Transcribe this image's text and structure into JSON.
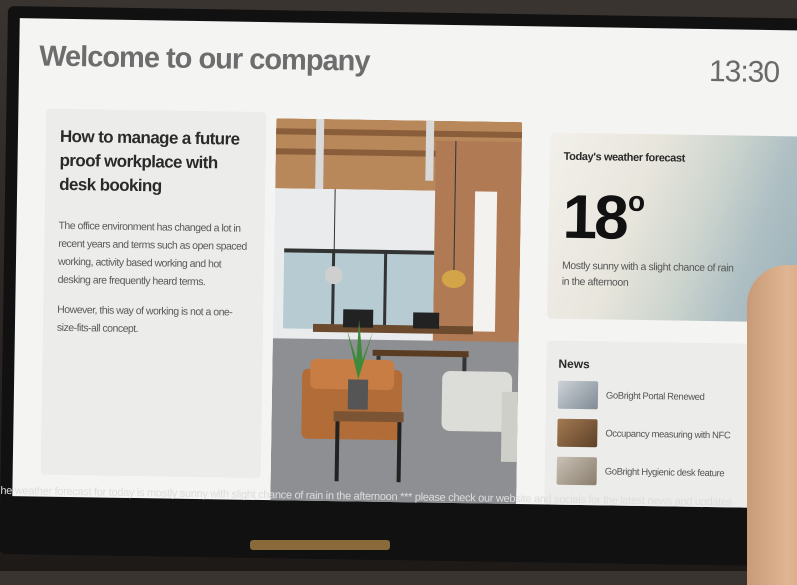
{
  "header": {
    "title": "Welcome to our company",
    "clock": "13:30"
  },
  "article": {
    "title": "How to manage a future proof workplace with desk booking",
    "paragraphs": [
      "The office environment has changed a lot in recent years and terms such as open spaced working, activity based working and hot desking are frequently heard terms.",
      "However, this way of working is not a one-size-fits-all concept."
    ]
  },
  "weather": {
    "title": "Today's weather forecast",
    "temperature": "18",
    "degree_symbol": "o",
    "description": "Mostly sunny with a slight chance of rain in the afternoon"
  },
  "news": {
    "title": "News",
    "items": [
      {
        "text": "GoBright Portal Renewed",
        "thumb_icon": "laptop-thumbnail"
      },
      {
        "text": "Occupancy measuring with NFC",
        "thumb_icon": "desk-thumbnail"
      },
      {
        "text": "GoBright Hygienic desk feature",
        "thumb_icon": "office-thumbnail"
      }
    ]
  },
  "ticker": {
    "text": "he weather forecast for today is mostly sunny with slight chance of rain in the afternoon *** please check our website and socials for the latest news and updates"
  },
  "colors": {
    "screen_bg": "#f4f4f3",
    "card_bg": "#ececea",
    "bezel": "#111111"
  }
}
